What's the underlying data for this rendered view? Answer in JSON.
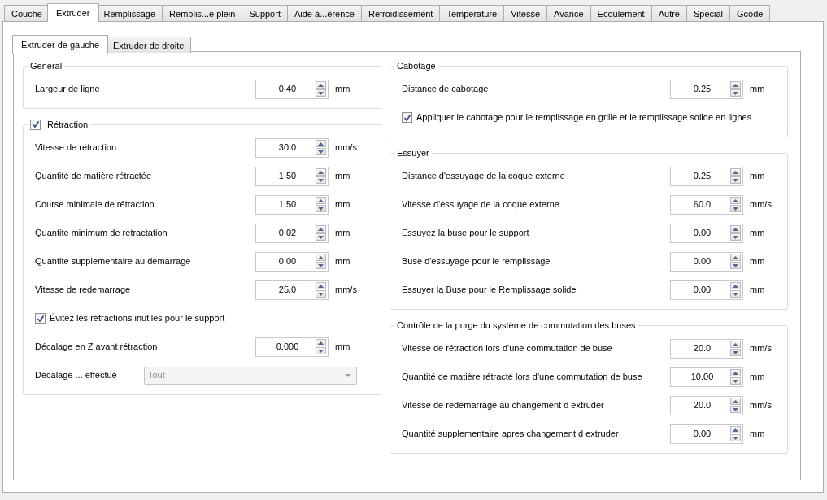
{
  "tabs": [
    {
      "label": "Couche",
      "selected": false
    },
    {
      "label": "Extruder",
      "selected": true
    },
    {
      "label": "Remplissage",
      "selected": false
    },
    {
      "label": "Remplis...e plein",
      "selected": false
    },
    {
      "label": "Support",
      "selected": false
    },
    {
      "label": "Aide à...èrence",
      "selected": false
    },
    {
      "label": "Refroidissement",
      "selected": false
    },
    {
      "label": "Temperature",
      "selected": false
    },
    {
      "label": "Vitesse",
      "selected": false
    },
    {
      "label": "Avancé",
      "selected": false
    },
    {
      "label": "Ecoulement",
      "selected": false
    },
    {
      "label": "Autre",
      "selected": false
    },
    {
      "label": "Special",
      "selected": false
    },
    {
      "label": "Gcode",
      "selected": false
    }
  ],
  "subtabs": [
    {
      "label": "Extruder de gauche",
      "selected": true
    },
    {
      "label": "Extruder de droite",
      "selected": false
    }
  ],
  "left_groups": [
    {
      "title": "General",
      "rows": [
        {
          "kind": "spin",
          "label": "Largeur de ligne",
          "value": "0.40",
          "unit": "mm"
        }
      ]
    },
    {
      "title": "Rétraction",
      "checked": true,
      "rows": [
        {
          "kind": "spin",
          "label": "Vitesse de rétraction",
          "value": "30.0",
          "unit": "mm/s"
        },
        {
          "kind": "spin",
          "label": "Quantité de matière rétractée",
          "value": "1.50",
          "unit": "mm"
        },
        {
          "kind": "spin",
          "label": "Course minimale de rétraction",
          "value": "1.50",
          "unit": "mm"
        },
        {
          "kind": "spin",
          "label": "Quantite minimum de retractation",
          "value": "0.02",
          "unit": "mm"
        },
        {
          "kind": "spin",
          "label": "Quantite supplementaire au demarrage",
          "value": "0.00",
          "unit": "mm"
        },
        {
          "kind": "spin",
          "label": "Vitesse de redemarrage",
          "value": "25.0",
          "unit": "mm/s"
        },
        {
          "kind": "check",
          "label": "Évitez les rétractions inutiles pour le support",
          "checked": true
        },
        {
          "kind": "spin",
          "label": "Décalage en Z avant rétraction",
          "value": "0.000",
          "unit": "mm"
        },
        {
          "kind": "combo",
          "label": "Décalage ... effectué",
          "value": "Tout",
          "disabled": true
        }
      ]
    }
  ],
  "right_groups": [
    {
      "title": "Cabotage",
      "rows": [
        {
          "kind": "spin",
          "label": "Distance de cabotage",
          "value": "0.25",
          "unit": "mm"
        },
        {
          "kind": "check",
          "label": "Appliquer le cabotage pour le remplissage en grille et le remplissage solide en lignes",
          "checked": true
        }
      ]
    },
    {
      "title": "Essuyer",
      "rows": [
        {
          "kind": "spin",
          "label": "Distance d'essuyage de la coque externe",
          "value": "0.25",
          "unit": "mm"
        },
        {
          "kind": "spin",
          "label": "Vitesse d'essuyage de la coque externe",
          "value": "60.0",
          "unit": "mm/s"
        },
        {
          "kind": "spin",
          "label": "Essuyez la buse pour le support",
          "value": "0.00",
          "unit": "mm"
        },
        {
          "kind": "spin",
          "label": "Buse d'essuyage pour le remplissage",
          "value": "0.00",
          "unit": "mm"
        },
        {
          "kind": "spin",
          "label": "Essuyer la Buse pour le Remplissage solide",
          "value": "0.00",
          "unit": "mm"
        }
      ]
    },
    {
      "title": "Contrôle de la purge du système de commutation des buses",
      "rows": [
        {
          "kind": "spin",
          "label": "Vitesse de rétraction lors d'une commutation de buse",
          "value": "20.0",
          "unit": "mm/s"
        },
        {
          "kind": "spin",
          "label": "Quantité de matière rétracté lors d'une commutation de buse",
          "value": "10.00",
          "unit": "mm"
        },
        {
          "kind": "spin",
          "label": "Vitesse de redemarrage au changement d extruder",
          "value": "20.0",
          "unit": "mm/s"
        },
        {
          "kind": "spin",
          "label": "Quantité supplementaire apres changement d extruder",
          "value": "0.00",
          "unit": "mm"
        }
      ]
    }
  ]
}
